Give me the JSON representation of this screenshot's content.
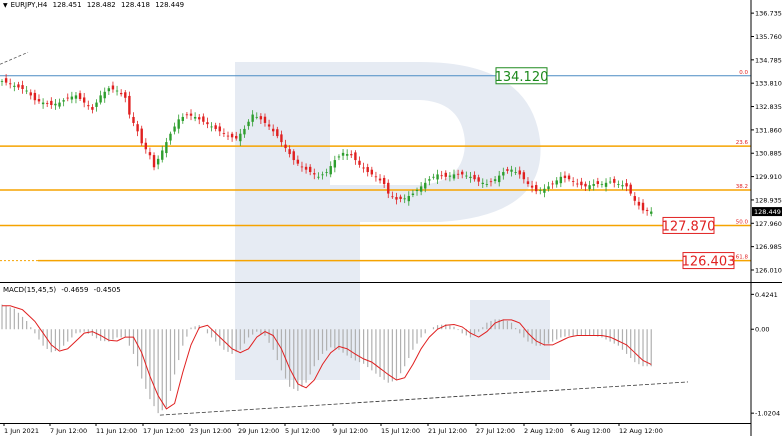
{
  "header": {
    "symbol": "EURJPY,H4",
    "ohlc": [
      "128.451",
      "128.482",
      "128.418",
      "128.449"
    ]
  },
  "macd_header": {
    "label": "MACD(15,45,5)",
    "values": [
      "-0.4659",
      "-0.4505"
    ]
  },
  "colors": {
    "bull": "#2e9e2e",
    "bear": "#e02020",
    "fib_line": "#f5a300",
    "resistance_line": "#4a8cc4",
    "target_green": "#1e8a1e",
    "target_red": "#e02020",
    "signal_line": "#e02020",
    "histogram": "#b0b0b0",
    "watermark": "#e6ebf3"
  },
  "chart_data": [
    {
      "type": "candlestick",
      "xlabel": "",
      "ylabel": "",
      "y_ticks": [
        "136.735",
        "135.760",
        "134.785",
        "133.810",
        "132.835",
        "131.860",
        "130.885",
        "129.910",
        "128.935",
        "127.960",
        "126.985",
        "126.010"
      ],
      "ylim": [
        125.55,
        137.2
      ],
      "x_ticks": [
        "1 Jun 2021",
        "7 Jun 12:00",
        "11 Jun 12:00",
        "17 Jun 12:00",
        "23 Jun 12:00",
        "29 Jun 12:00",
        "5 Jul 12:00",
        "9 Jul 12:00",
        "15 Jul 12:00",
        "21 Jul 12:00",
        "27 Jul 12:00",
        "2 Aug 12:00",
        "6 Aug 12:00",
        "12 Aug 12:00"
      ],
      "last_price": "128.449",
      "fib_levels": [
        {
          "ratio": "0.0",
          "price": 134.12
        },
        {
          "ratio": "23.6",
          "price": 131.18
        },
        {
          "ratio": "38.2",
          "price": 129.35
        },
        {
          "ratio": "50.0",
          "price": 127.87
        },
        {
          "ratio": "61.8",
          "price": 126.403
        }
      ],
      "target_labels": [
        {
          "text": "134.120",
          "price": 134.12,
          "style": "green"
        },
        {
          "text": "127.870",
          "price": 127.87,
          "style": "red"
        },
        {
          "text": "126.403",
          "price": 126.403,
          "style": "red"
        }
      ],
      "close_path": [
        [
          0,
          133.9
        ],
        [
          3,
          133.7
        ],
        [
          6,
          133.5
        ],
        [
          8,
          133.1
        ],
        [
          10,
          133.0
        ],
        [
          12,
          132.9
        ],
        [
          14,
          133.0
        ],
        [
          16,
          133.2
        ],
        [
          18,
          133.3
        ],
        [
          20,
          133.0
        ],
        [
          22,
          132.7
        ],
        [
          24,
          133.3
        ],
        [
          26,
          133.6
        ],
        [
          28,
          133.5
        ],
        [
          30,
          133.2
        ],
        [
          31,
          132.5
        ],
        [
          33,
          131.8
        ],
        [
          34,
          131.3
        ],
        [
          36,
          130.8
        ],
        [
          37,
          130.3
        ],
        [
          39,
          131.0
        ],
        [
          41,
          131.7
        ],
        [
          43,
          132.3
        ],
        [
          45,
          132.5
        ],
        [
          47,
          132.4
        ],
        [
          49,
          132.2
        ],
        [
          51,
          132.0
        ],
        [
          53,
          131.8
        ],
        [
          55,
          131.6
        ],
        [
          57,
          131.5
        ],
        [
          59,
          131.9
        ],
        [
          61,
          132.5
        ],
        [
          63,
          132.3
        ],
        [
          65,
          132.0
        ],
        [
          67,
          131.6
        ],
        [
          69,
          131.1
        ],
        [
          71,
          130.6
        ],
        [
          73,
          130.3
        ],
        [
          75,
          130.1
        ],
        [
          77,
          129.9
        ],
        [
          79,
          130.1
        ],
        [
          81,
          130.6
        ],
        [
          83,
          130.9
        ],
        [
          85,
          130.8
        ],
        [
          87,
          130.4
        ],
        [
          89,
          130.1
        ],
        [
          91,
          129.9
        ],
        [
          93,
          129.6
        ],
        [
          94,
          129.2
        ],
        [
          96,
          128.95
        ],
        [
          98,
          129.0
        ],
        [
          100,
          129.2
        ],
        [
          102,
          129.5
        ],
        [
          104,
          129.8
        ],
        [
          106,
          130.0
        ],
        [
          108,
          129.9
        ],
        [
          110,
          130.0
        ],
        [
          112,
          130.0
        ],
        [
          114,
          129.9
        ],
        [
          116,
          129.7
        ],
        [
          118,
          129.6
        ],
        [
          120,
          129.8
        ],
        [
          122,
          130.1
        ],
        [
          124,
          130.2
        ],
        [
          126,
          130.0
        ],
        [
          128,
          129.6
        ],
        [
          130,
          129.3
        ],
        [
          132,
          129.4
        ],
        [
          134,
          129.6
        ],
        [
          136,
          129.9
        ],
        [
          138,
          129.8
        ],
        [
          140,
          129.6
        ],
        [
          142,
          129.5
        ],
        [
          144,
          129.6
        ],
        [
          146,
          129.6
        ],
        [
          148,
          129.7
        ],
        [
          150,
          129.6
        ],
        [
          152,
          129.5
        ],
        [
          154,
          128.9
        ],
        [
          156,
          128.5
        ],
        [
          158,
          128.45
        ]
      ],
      "last_bar_index": 158
    },
    {
      "type": "bar",
      "name": "",
      "y_ticks": [
        "0.4241",
        "0.00",
        "-1.0204"
      ],
      "ylim": [
        -1.14,
        0.55
      ],
      "histogram_path": [
        [
          0,
          0.3
        ],
        [
          3,
          0.25
        ],
        [
          6,
          0.1
        ],
        [
          8,
          -0.05
        ],
        [
          10,
          -0.2
        ],
        [
          12,
          -0.28
        ],
        [
          14,
          -0.25
        ],
        [
          16,
          -0.15
        ],
        [
          18,
          -0.05
        ],
        [
          20,
          -0.03
        ],
        [
          22,
          -0.08
        ],
        [
          24,
          -0.14
        ],
        [
          26,
          -0.15
        ],
        [
          28,
          -0.1
        ],
        [
          30,
          -0.1
        ],
        [
          32,
          -0.3
        ],
        [
          34,
          -0.6
        ],
        [
          36,
          -0.85
        ],
        [
          38,
          -1.02
        ],
        [
          40,
          -0.95
        ],
        [
          42,
          -0.55
        ],
        [
          44,
          -0.2
        ],
        [
          46,
          0.02
        ],
        [
          48,
          0.05
        ],
        [
          50,
          -0.05
        ],
        [
          52,
          -0.15
        ],
        [
          54,
          -0.25
        ],
        [
          56,
          -0.3
        ],
        [
          58,
          -0.25
        ],
        [
          60,
          -0.1
        ],
        [
          62,
          -0.03
        ],
        [
          64,
          -0.08
        ],
        [
          66,
          -0.25
        ],
        [
          68,
          -0.5
        ],
        [
          70,
          -0.7
        ],
        [
          72,
          -0.75
        ],
        [
          74,
          -0.65
        ],
        [
          76,
          -0.45
        ],
        [
          78,
          -0.3
        ],
        [
          80,
          -0.22
        ],
        [
          82,
          -0.25
        ],
        [
          84,
          -0.32
        ],
        [
          86,
          -0.38
        ],
        [
          88,
          -0.42
        ],
        [
          90,
          -0.5
        ],
        [
          92,
          -0.58
        ],
        [
          94,
          -0.65
        ],
        [
          96,
          -0.62
        ],
        [
          98,
          -0.45
        ],
        [
          100,
          -0.25
        ],
        [
          102,
          -0.1
        ],
        [
          104,
          0.0
        ],
        [
          106,
          0.05
        ],
        [
          108,
          0.06
        ],
        [
          110,
          0.03
        ],
        [
          112,
          -0.05
        ],
        [
          114,
          -0.1
        ],
        [
          116,
          -0.03
        ],
        [
          118,
          0.08
        ],
        [
          120,
          0.12
        ],
        [
          122,
          0.12
        ],
        [
          124,
          0.08
        ],
        [
          126,
          -0.05
        ],
        [
          128,
          -0.15
        ],
        [
          130,
          -0.2
        ],
        [
          132,
          -0.2
        ],
        [
          134,
          -0.15
        ],
        [
          136,
          -0.1
        ],
        [
          138,
          -0.08
        ],
        [
          140,
          -0.08
        ],
        [
          142,
          -0.08
        ],
        [
          144,
          -0.08
        ],
        [
          146,
          -0.1
        ],
        [
          148,
          -0.15
        ],
        [
          150,
          -0.2
        ],
        [
          152,
          -0.3
        ],
        [
          154,
          -0.4
        ],
        [
          156,
          -0.45
        ],
        [
          158,
          -0.45
        ]
      ],
      "trendline": [
        [
          36,
          -1.02
        ],
        [
          160,
          -0.58
        ]
      ]
    }
  ]
}
